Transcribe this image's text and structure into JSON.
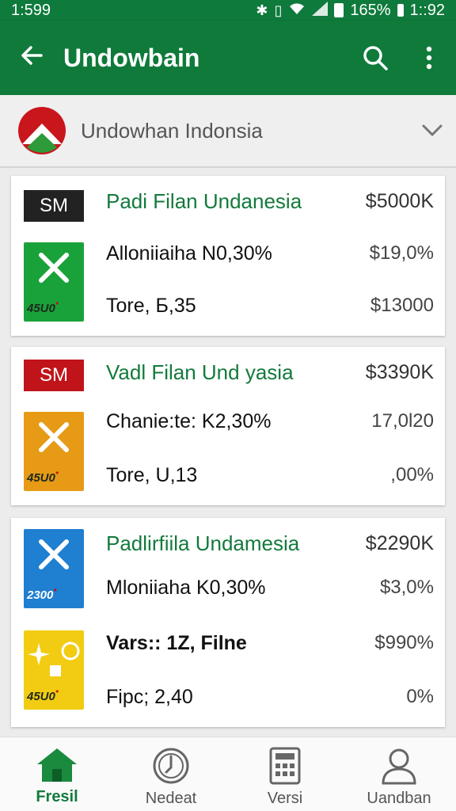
{
  "status_bar": {
    "time_left": "1:599",
    "battery": "165%",
    "time_right": "1::92"
  },
  "app_bar": {
    "title": "Undowbain"
  },
  "region": {
    "label": "Undowhan Indonsia"
  },
  "cards": [
    {
      "badge": "SM",
      "badge_color": "#222222",
      "name": "Padi Filan Undanesia",
      "name_value": "$5000K",
      "line1": "Alloniiaiha N0,30%",
      "line1_value": "$19,0%",
      "thumb_color": "#1aa23a",
      "thumb_icon": "x-icon",
      "thumb_caption": "45U0",
      "line2": "Tore, Б,35",
      "line2_value": "$13000"
    },
    {
      "badge": "SM",
      "badge_color": "#c0141a",
      "name": "Vadl Filan Und yasia",
      "name_value": "$3390K",
      "line1": "Chanie:te: K2,30%",
      "line1_value": "17,0l20",
      "thumb_color": "#e69a16",
      "thumb_icon": "x-icon",
      "thumb_caption": "45U0",
      "line2": "Tore, U,13",
      "line2_value": ",00%"
    },
    {
      "name": "Padlirfiila Undamesia",
      "name_value": "$2290K",
      "line1": "Mloniiaha K0,30%",
      "line1_value": "$3,0%",
      "thumb_color": "#1f7fd0",
      "thumb_icon": "x-icon",
      "thumb_caption": "2300",
      "thumb2_color": "#f2cc12",
      "thumb2_icon": "sparkle-icon",
      "thumb2_caption": "45U0",
      "line2": "Vars:: 1Z, Filne",
      "line2_value": "$990%",
      "line3": "Fipc; 2,40",
      "line3_value": "0%"
    }
  ],
  "bottom_nav": [
    {
      "label": "Fresil",
      "icon": "home-icon",
      "active": true
    },
    {
      "label": "Nedeat",
      "icon": "clock-icon",
      "active": false
    },
    {
      "label": "Versi",
      "icon": "calculator-icon",
      "active": false
    },
    {
      "label": "Uandban",
      "icon": "person-icon",
      "active": false
    }
  ],
  "colors": {
    "brand_green": "#0f7a3a",
    "accent_green_text": "#137a3c"
  }
}
